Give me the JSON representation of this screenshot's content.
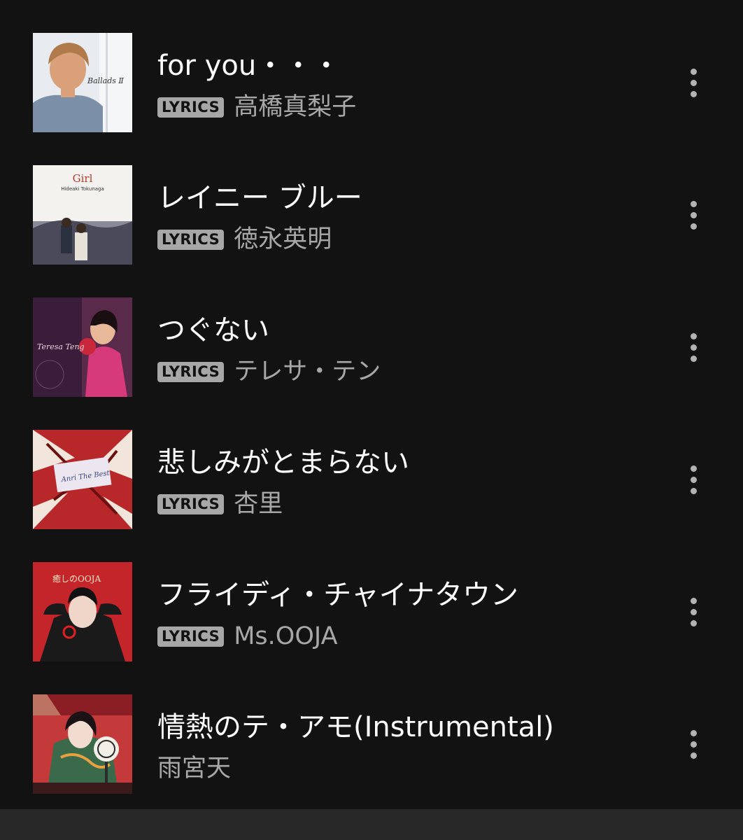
{
  "tracks": [
    {
      "title": "for you・・・",
      "badge": "LYRICS",
      "artist": "高橋真梨子",
      "cover_icon": "album-cover"
    },
    {
      "title": "レイニー ブルー",
      "badge": "LYRICS",
      "artist": "徳永英明",
      "cover_icon": "album-cover"
    },
    {
      "title": "つぐない",
      "badge": "LYRICS",
      "artist": "テレサ・テン",
      "cover_icon": "album-cover"
    },
    {
      "title": "悲しみがとまらない",
      "badge": "LYRICS",
      "artist": "杏里",
      "cover_icon": "album-cover"
    },
    {
      "title": "フライディ・チャイナタウン",
      "badge": "LYRICS",
      "artist": "Ms.OOJA",
      "cover_icon": "album-cover"
    },
    {
      "title": "情熱のテ・アモ(Instrumental)",
      "badge": "",
      "artist": "雨宮天",
      "cover_icon": "album-cover"
    }
  ],
  "covers": {
    "0": {
      "text": "Ballads Ⅱ"
    },
    "1": {
      "text": "Girl",
      "subtext": "Hideaki Tokunaga"
    },
    "2": {
      "text": "Teresa Teng"
    },
    "3": {
      "text": "Anri The Best"
    },
    "4": {
      "text": "癒しのOOJA"
    },
    "5": {
      "text": ""
    }
  },
  "colors": {
    "background": "#121212",
    "title": "#ffffff",
    "artist": "#a7a7a7",
    "badge_bg": "#a7a7a7",
    "more_icon": "#b3b3b3",
    "bottom_bar": "#282828"
  },
  "more_icon": "more-vertical-icon"
}
